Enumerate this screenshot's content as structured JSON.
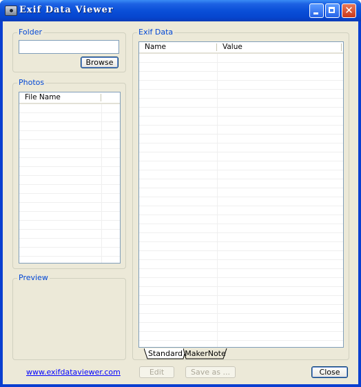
{
  "window": {
    "title": "Exif Data Viewer"
  },
  "folder": {
    "group_label": "Folder",
    "path_value": "",
    "browse_label": "Browse"
  },
  "photos": {
    "group_label": "Photos",
    "columns": [
      "File Name"
    ]
  },
  "preview": {
    "group_label": "Preview"
  },
  "exif": {
    "group_label": "Exif Data",
    "columns": [
      "Name",
      "Value"
    ],
    "tabs": [
      "Standard",
      "MakerNote"
    ],
    "active_tab": "Standard"
  },
  "footer": {
    "link_text": "www.exifdataviewer.com",
    "edit_label": "Edit",
    "save_label": "Save as ...",
    "close_label": "Close"
  },
  "colors": {
    "titlebar": "#0a4fd8",
    "client_bg": "#ece9d8",
    "group_title": "#0046d5",
    "link": "#0000ff"
  },
  "icons": [
    "camera-app-icon",
    "minimize-icon",
    "maximize-icon",
    "close-icon"
  ]
}
